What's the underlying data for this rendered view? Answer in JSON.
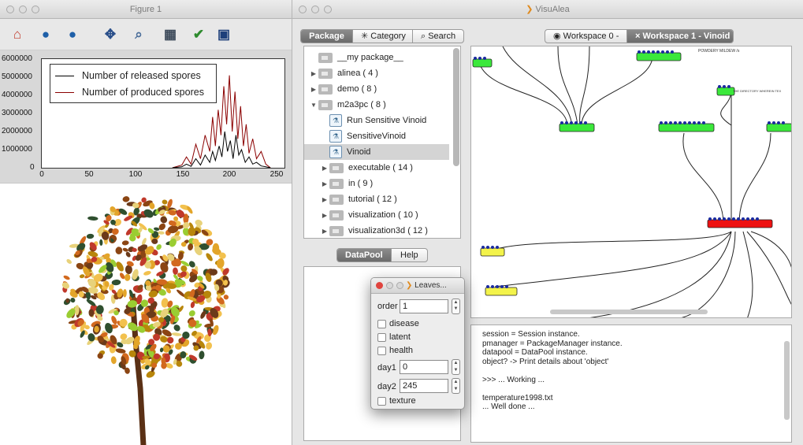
{
  "figure_window": {
    "title": "Figure 1",
    "toolbar": [
      "home-icon",
      "back-icon",
      "forward-icon",
      "pan-icon",
      "zoom-icon",
      "subplots-icon",
      "check-icon",
      "save-icon"
    ]
  },
  "chart_data": {
    "type": "line",
    "ylim": [
      0,
      6000000
    ],
    "xlim": [
      0,
      260
    ],
    "yticks": [
      "6000000",
      "5000000",
      "4000000",
      "3000000",
      "2000000",
      "1000000",
      "0"
    ],
    "xticks": [
      "0",
      "50",
      "100",
      "150",
      "200",
      "250"
    ],
    "legend_position": "top-left",
    "series": [
      {
        "name": "Number of released spores",
        "color": "#000000",
        "x": [
          140,
          150,
          155,
          160,
          165,
          170,
          175,
          180,
          183,
          186,
          190,
          193,
          196,
          199,
          202,
          205,
          208,
          211,
          214,
          218,
          222,
          226,
          230,
          235,
          240,
          245
        ],
        "y": [
          0,
          50000,
          200000,
          80000,
          500000,
          150000,
          700000,
          300000,
          900000,
          400000,
          1200000,
          600000,
          2000000,
          900000,
          1500000,
          500000,
          1800000,
          700000,
          1000000,
          300000,
          600000,
          200000,
          300000,
          100000,
          50000,
          0
        ]
      },
      {
        "name": "Number of produced spores",
        "color": "#8b0000",
        "x": [
          140,
          150,
          155,
          160,
          165,
          170,
          175,
          180,
          183,
          186,
          189,
          192,
          195,
          198,
          201,
          204,
          207,
          210,
          213,
          216,
          219,
          222,
          226,
          230,
          235,
          240,
          245
        ],
        "y": [
          0,
          150000,
          600000,
          200000,
          1300000,
          500000,
          1800000,
          900000,
          2800000,
          1200000,
          3200000,
          1800000,
          4500000,
          2400000,
          5100000,
          2000000,
          4200000,
          1600000,
          3400000,
          1200000,
          2400000,
          800000,
          1600000,
          500000,
          900000,
          200000,
          0
        ]
      }
    ]
  },
  "visualea": {
    "title": "VisuAlea",
    "left_tabs": [
      "Package",
      "Category",
      "Search"
    ],
    "workspace_tabs": [
      "Workspace 0 -",
      "Workspace 1 - Vinoid"
    ],
    "tree": [
      {
        "label": "__my package__",
        "arrow": "",
        "indent": 0,
        "icon": "folder"
      },
      {
        "label": "alinea ( 4 )",
        "arrow": "▶",
        "indent": 0,
        "icon": "folder"
      },
      {
        "label": "demo ( 8 )",
        "arrow": "▶",
        "indent": 0,
        "icon": "folder"
      },
      {
        "label": "m2a3pc ( 8 )",
        "arrow": "▼",
        "indent": 0,
        "icon": "folder"
      },
      {
        "label": "Run Sensitive Vinoid",
        "arrow": "",
        "indent": 1,
        "icon": "node"
      },
      {
        "label": "SensitiveVinoid",
        "arrow": "",
        "indent": 1,
        "icon": "node"
      },
      {
        "label": "Vinoid",
        "arrow": "",
        "indent": 1,
        "icon": "node",
        "selected": true
      },
      {
        "label": "executable ( 14 )",
        "arrow": "▶",
        "indent": 1,
        "icon": "folder"
      },
      {
        "label": "in ( 9 )",
        "arrow": "▶",
        "indent": 1,
        "icon": "folder"
      },
      {
        "label": "tutorial ( 12 )",
        "arrow": "▶",
        "indent": 1,
        "icon": "folder"
      },
      {
        "label": "visualization ( 10 )",
        "arrow": "▶",
        "indent": 1,
        "icon": "folder"
      },
      {
        "label": "visualization3d ( 12 )",
        "arrow": "▶",
        "indent": 1,
        "icon": "folder"
      }
    ],
    "bottom_tabs": [
      "DataPool",
      "Help"
    ],
    "graph_label": "POWDERY MILDEW /s",
    "graph_label2": "THE DIRECTORY WHEREIN TEX",
    "shell_lines": [
      "session = Session instance.",
      "pmanager = PackageManager instance.",
      "datapool = DataPool instance.",
      "object? -> Print details about 'object'",
      "",
      ">>> ... Working ...",
      "",
      "temperature1998.txt",
      "... Well done ..."
    ]
  },
  "dialog": {
    "title": "Leaves...",
    "order_label": "order",
    "order_value": "1",
    "checkboxes": [
      "disease",
      "latent",
      "health"
    ],
    "day1_label": "day1",
    "day1_value": "0",
    "day2_label": "day2",
    "day2_value": "245",
    "texture_label": "texture"
  }
}
